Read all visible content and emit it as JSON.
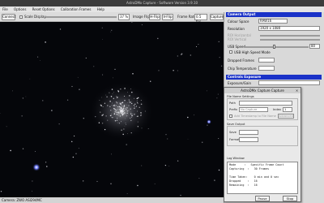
{
  "window": {
    "title": "AstroDMx Capture - Software Version 3.9.10"
  },
  "menu": [
    "File",
    "Options",
    "Reset Options",
    "Calibration Frames",
    "Help"
  ],
  "toolbar": {
    "connect_label": "Connect",
    "scale_display_label": "Scale Display",
    "zoom_value": "37 %",
    "image_flip_label": "Image Flip",
    "h_flip_label": "H-Flip",
    "v_flip_label": "V-Flip",
    "frame_rate_label": "Frame Rate",
    "frame_rate_value": "0.5 fps",
    "capture_label": "Capture"
  },
  "status": {
    "text": "Camera: ZWO ASI294MC"
  },
  "camera_output": {
    "header": "Camera Output",
    "colour_space_label": "Colour Space",
    "colour_space_value": "RAW16",
    "resolution_label": "Resolution",
    "resolution_value": "1920 x 1080",
    "roi_horizontal_label": "ROI Horizontal",
    "roi_vertical_label": "ROI Vertical",
    "usb_speed_label": "USB Speed",
    "usb_speed_value": "80",
    "high_speed_label": "USB High Speed Mode",
    "dropped_frames_label": "Dropped Frames",
    "chip_temperature_label": "Chip Temperature"
  },
  "controls_exposure": {
    "header": "Controls Exposure",
    "exposure_label": "Exposure/Gain"
  },
  "dialog": {
    "title": "AstroDMx Capture Capture",
    "file_name_settings": "File Name Settings",
    "path_label": "Path",
    "prefix_label": "Prefix",
    "prefix_value": "No Capture",
    "index_label": "Index",
    "index_value": "1",
    "add_timestamp_label": "Add Timestamp to File Name",
    "advanced_label": "Advanced",
    "save_output_label": "Save Output",
    "save_label": "Save",
    "format_label": "Format",
    "log_window_label": "Log Window",
    "log_lines": [
      "Mode     :   Specific Frame Count",
      "Capturing  :   30 Frames",
      "",
      "Time Taken:    0 min and 0 sec",
      "Dropped    :   16",
      "Remaining  :   16"
    ],
    "pause_label": "Pause",
    "stop_label": "Stop"
  },
  "colors": {
    "section_header": "#1a32c8",
    "preview_bg": "#05060a"
  }
}
